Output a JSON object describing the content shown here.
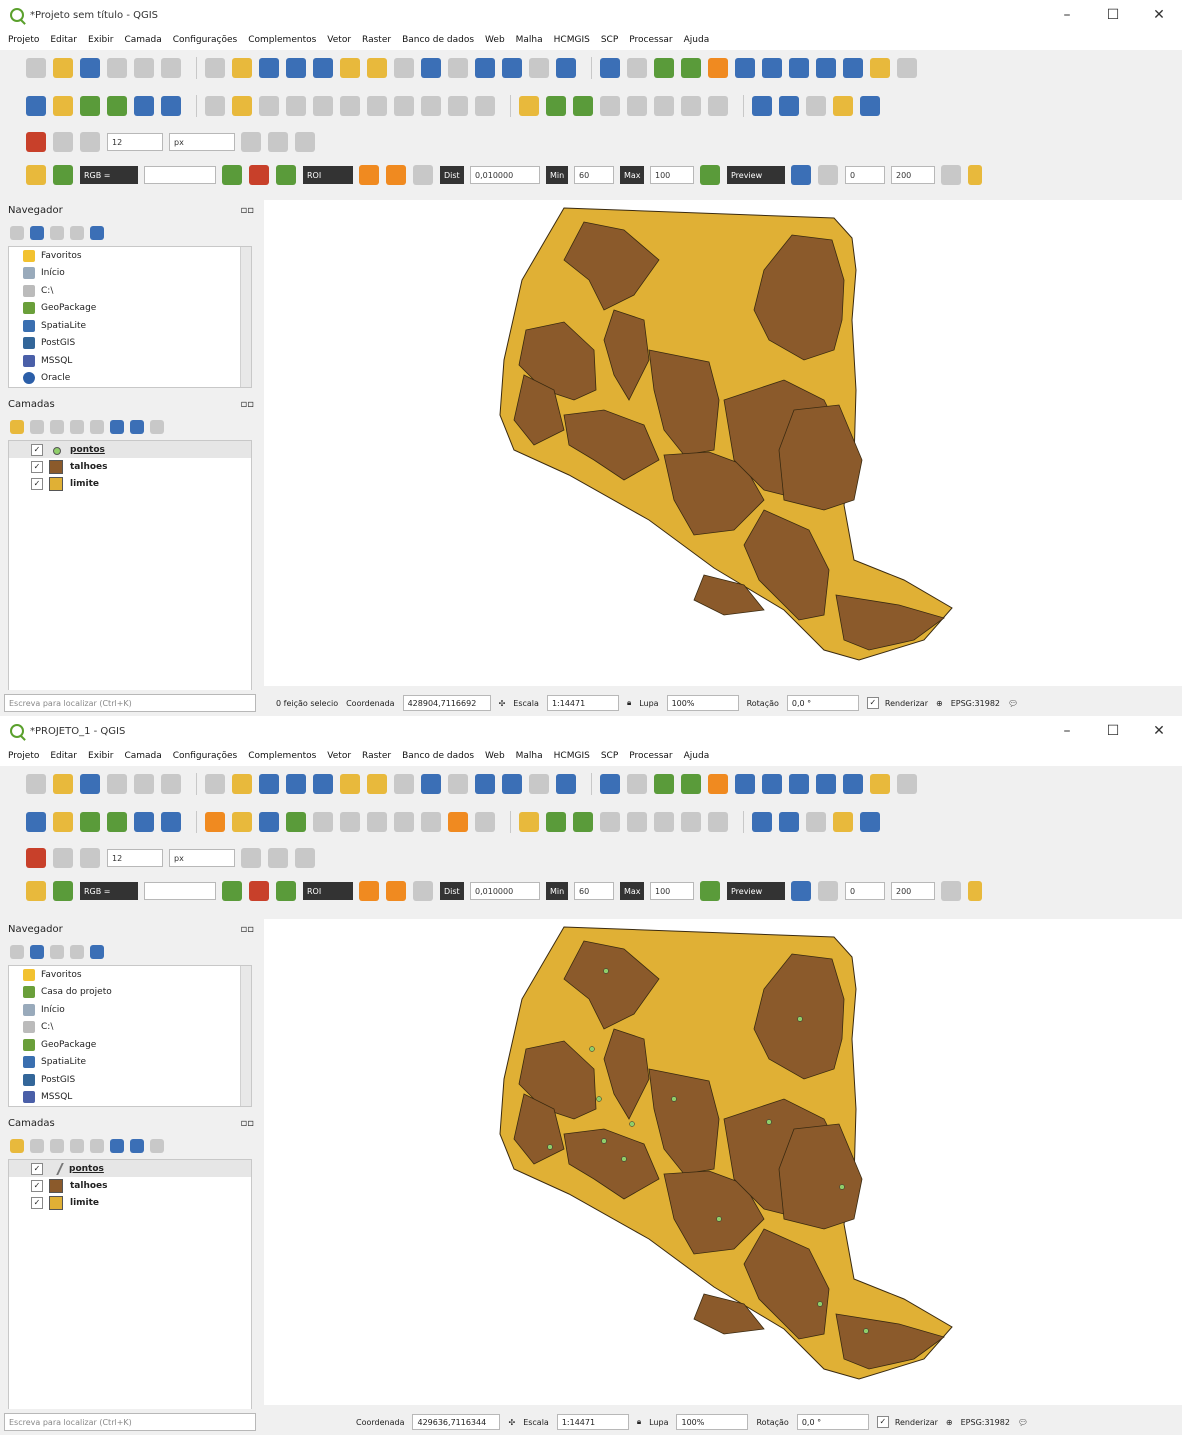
{
  "colors": {
    "field_fill": "#8b5a2b",
    "boundary_fill": "#e0b035",
    "point_fill": "#8fce6a",
    "outline": "#3a2a10",
    "selected_row": "#e6e6e6"
  },
  "windows": [
    {
      "title": "*Projeto sem título - QGIS",
      "menus": [
        "Projeto",
        "Editar",
        "Exibir",
        "Camada",
        "Configurações",
        "Complementos",
        "Vetor",
        "Raster",
        "Banco de dados",
        "Web",
        "Malha",
        "HCMGIS",
        "SCP",
        "Processar",
        "Ajuda"
      ],
      "scp_toolbar": {
        "rgb": "RGB =",
        "roi": "ROI",
        "dist_label": "Dist",
        "dist": "0,010000",
        "min_label": "Min",
        "min": "60",
        "max_label": "Max",
        "max": "100",
        "preview": "Preview",
        "field_a": "0",
        "field_b": "200"
      },
      "snap": {
        "size": "12",
        "unit": "px"
      },
      "navigator_title": "Navegador",
      "navigator_items": [
        "Favoritos",
        "Início",
        "C:\\",
        "GeoPackage",
        "SpatiaLite",
        "PostGIS",
        "MSSQL",
        "Oracle"
      ],
      "layers_title": "Camadas",
      "layers": [
        "pontos",
        "talhoes",
        "limite"
      ],
      "status": {
        "locator": "Escreva para localizar (Ctrl+K)",
        "selection": "0 feição selecio",
        "coord_label": "Coordenada",
        "coord": "428904,7116692",
        "scale_label": "Escala",
        "scale": "1:14471",
        "zoom_label": "Lupa",
        "zoom": "100%",
        "rot_label": "Rotação",
        "rot": "0,0 °",
        "render": "Renderizar",
        "crs": "EPSG:31982"
      }
    },
    {
      "title": "*PROJETO_1 - QGIS",
      "menus": [
        "Projeto",
        "Editar",
        "Exibir",
        "Camada",
        "Configurações",
        "Complementos",
        "Vetor",
        "Raster",
        "Banco de dados",
        "Web",
        "Malha",
        "HCMGIS",
        "SCP",
        "Processar",
        "Ajuda"
      ],
      "scp_toolbar": {
        "rgb": "RGB =",
        "roi": "ROI",
        "dist_label": "Dist",
        "dist": "0,010000",
        "min_label": "Min",
        "min": "60",
        "max_label": "Max",
        "max": "100",
        "preview": "Preview",
        "field_a": "0",
        "field_b": "200"
      },
      "snap": {
        "size": "12",
        "unit": "px"
      },
      "navigator_title": "Navegador",
      "navigator_items": [
        "Favoritos",
        "Casa do projeto",
        "Início",
        "C:\\",
        "GeoPackage",
        "SpatiaLite",
        "PostGIS",
        "MSSQL"
      ],
      "layers_title": "Camadas",
      "layers": [
        "pontos",
        "talhoes",
        "limite"
      ],
      "status": {
        "locator": "Escreva para localizar (Ctrl+K)",
        "selection": "",
        "coord_label": "Coordenada",
        "coord": "429636,7116344",
        "scale_label": "Escala",
        "scale": "1:14471",
        "zoom_label": "Lupa",
        "zoom": "100%",
        "rot_label": "Rotação",
        "rot": "0,0 °",
        "render": "Renderizar",
        "crs": "EPSG:31982"
      }
    }
  ]
}
